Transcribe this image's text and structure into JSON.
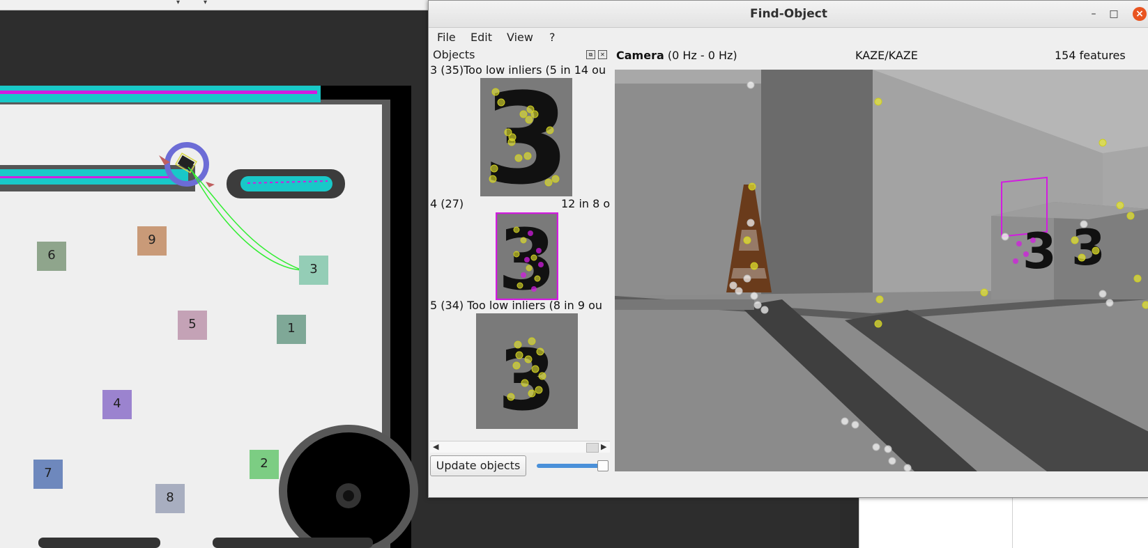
{
  "window": {
    "title": "Find-Object",
    "minimize": "–",
    "maximize": "□",
    "close": "×"
  },
  "menu": [
    "File",
    "Edit",
    "View",
    "?"
  ],
  "objects_panel": {
    "title": "Objects",
    "objects": [
      {
        "label": "3 (35)Too low inliers (5 in 14 ou",
        "digit": "3"
      },
      {
        "label_left": "4 (27)",
        "label_right": "12 in 8 o",
        "digit": "3"
      },
      {
        "label": "5 (34)  Too low inliers (8 in 9 ou",
        "digit": "3"
      }
    ],
    "update_button": "Update objects",
    "slider_value": 0.95
  },
  "camera": {
    "title": "Camera",
    "rate": " (0 Hz - 0 Hz)",
    "detector": "KAZE/KAZE",
    "features": "154 features"
  },
  "map": {
    "boxes": [
      {
        "label": "6",
        "color": "#8fa58c"
      },
      {
        "label": "9",
        "color": "#c99a78"
      },
      {
        "label": "3",
        "color": "#94cdb6"
      },
      {
        "label": "5",
        "color": "#c4a2b6"
      },
      {
        "label": "1",
        "color": "#7fa897"
      },
      {
        "label": "4",
        "color": "#9b83cf"
      },
      {
        "label": "7",
        "color": "#6e88bd"
      },
      {
        "label": "2",
        "color": "#7ccd83"
      },
      {
        "label": "8",
        "color": "#a8aec0"
      }
    ],
    "colors": {
      "obstacle": "#000000",
      "inflation": "#19c8c8",
      "path": "#d21ce0",
      "free": "#efefef",
      "robot_ring": "#6c6cd6",
      "plan": "#33ee33"
    }
  },
  "colors": {
    "accent": "#e95420",
    "keypoint": "#e8e832",
    "match": "#d21ce0"
  }
}
